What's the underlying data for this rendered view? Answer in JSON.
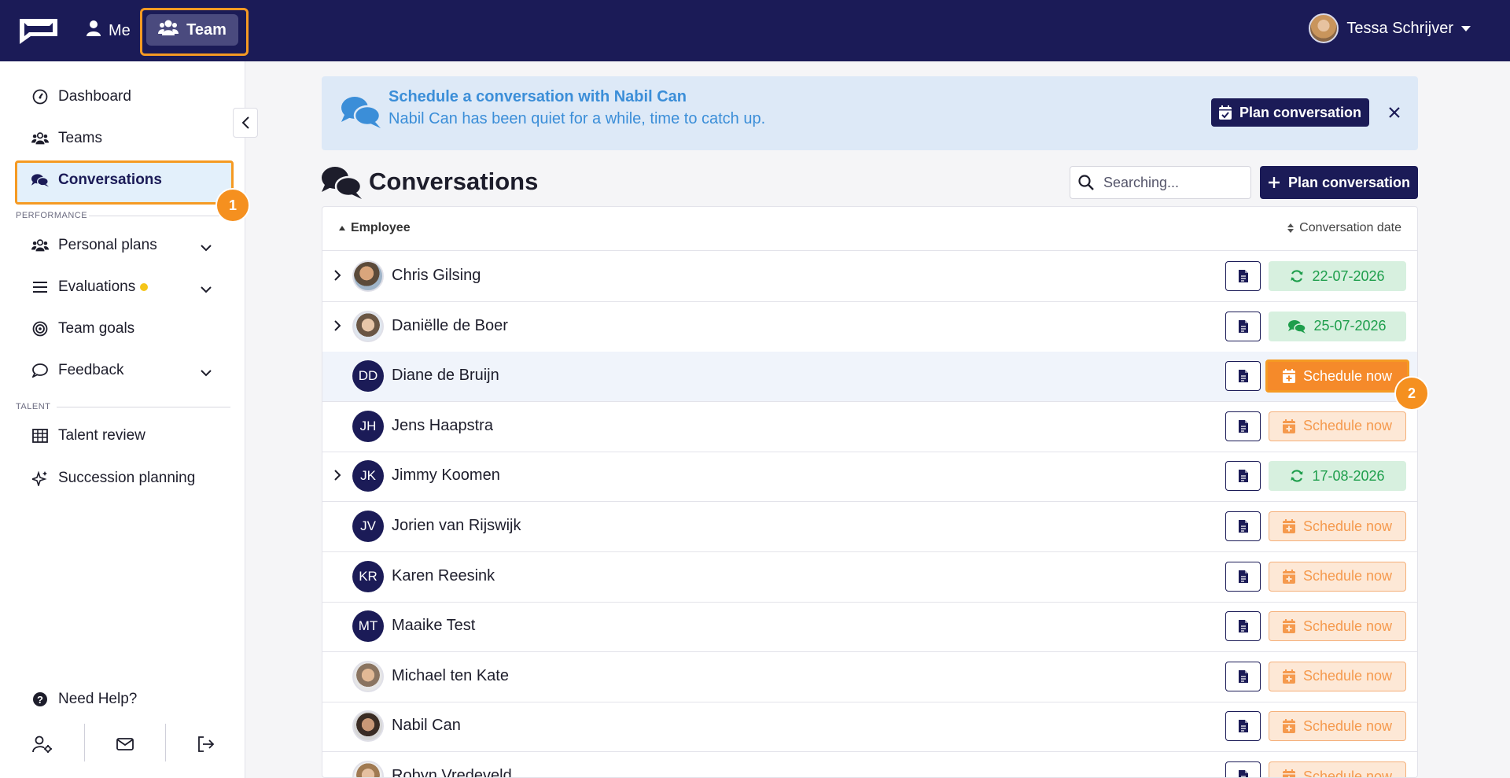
{
  "topbar": {
    "me_label": "Me",
    "team_label": "Team",
    "user_name": "Tessa Schrijver"
  },
  "sidebar": {
    "items": [
      {
        "label": "Dashboard",
        "icon": "gauge-icon"
      },
      {
        "label": "Teams",
        "icon": "users-icon"
      },
      {
        "label": "Conversations",
        "icon": "comments-icon"
      },
      {
        "label": "Personal plans",
        "icon": "users-icon"
      },
      {
        "label": "Evaluations",
        "icon": "list-icon"
      },
      {
        "label": "Team goals",
        "icon": "target-icon"
      },
      {
        "label": "Feedback",
        "icon": "comment-icon"
      },
      {
        "label": "Talent review",
        "icon": "table-icon"
      },
      {
        "label": "Succession planning",
        "icon": "sparkle-icon"
      }
    ],
    "section_performance": "PERFORMANCE",
    "section_talent": "TALENT",
    "need_help": "Need Help?",
    "step1": "1"
  },
  "banner": {
    "title": "Schedule a conversation with Nabil Can",
    "text": "Nabil Can has been quiet for a while, time to catch up.",
    "button": "Plan conversation"
  },
  "header": {
    "title": "Conversations",
    "search_placeholder": "Searching...",
    "plan_button": "Plan conversation"
  },
  "table": {
    "col_employee": "Employee",
    "col_date": "Conversation date",
    "step2": "2",
    "rows": [
      {
        "initials": "",
        "name": "Chris Gilsing",
        "expandable": true,
        "status": "22-07-2026",
        "status_type": "green-recurring"
      },
      {
        "initials": "",
        "name": "Daniëlle de Boer",
        "expandable": true,
        "status": "25-07-2026",
        "status_type": "green-chat"
      },
      {
        "initials": "DD",
        "name": "Diane de Bruijn",
        "expandable": false,
        "status": "Schedule now",
        "status_type": "orange-active"
      },
      {
        "initials": "JH",
        "name": "Jens Haapstra",
        "expandable": false,
        "status": "Schedule now",
        "status_type": "orange"
      },
      {
        "initials": "JK",
        "name": "Jimmy Koomen",
        "expandable": true,
        "status": "17-08-2026",
        "status_type": "green-recurring"
      },
      {
        "initials": "JV",
        "name": "Jorien van Rijswijk",
        "expandable": false,
        "status": "Schedule now",
        "status_type": "orange"
      },
      {
        "initials": "KR",
        "name": "Karen Reesink",
        "expandable": false,
        "status": "Schedule now",
        "status_type": "orange"
      },
      {
        "initials": "MT",
        "name": "Maaike Test",
        "expandable": false,
        "status": "Schedule now",
        "status_type": "orange"
      },
      {
        "initials": "",
        "name": "Michael ten Kate",
        "expandable": false,
        "status": "Schedule now",
        "status_type": "orange"
      },
      {
        "initials": "",
        "name": "Nabil Can",
        "expandable": false,
        "status": "Schedule now",
        "status_type": "orange"
      },
      {
        "initials": "",
        "name": "Robyn Vredeveld",
        "expandable": false,
        "status": "Schedule now",
        "status_type": "orange"
      }
    ]
  },
  "colors": {
    "navy": "#1b1b57",
    "accent_orange": "#f59a23",
    "green": "#1e9e4c",
    "banner_blue": "#3b8ed8"
  }
}
